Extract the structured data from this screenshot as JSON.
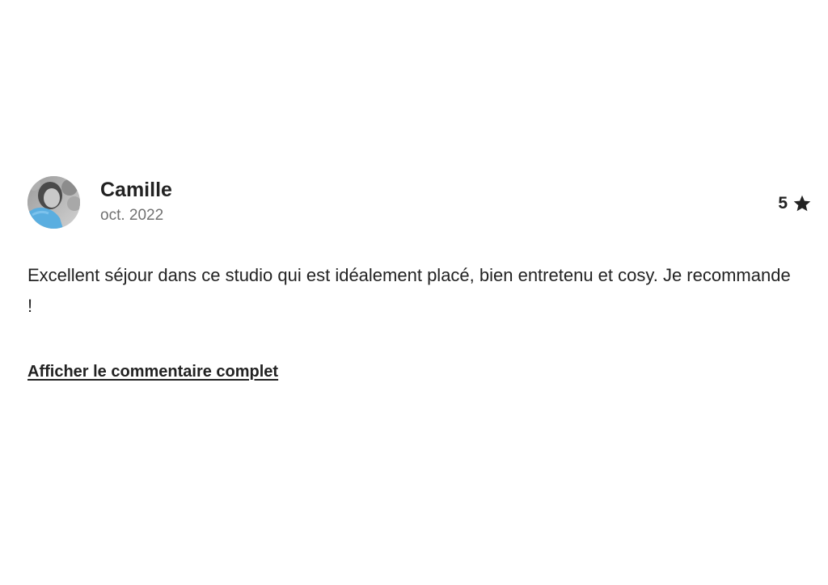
{
  "review": {
    "reviewer_name": "Camille",
    "date": "oct. 2022",
    "rating": "5",
    "rating_icon": "star-icon",
    "text": "Excellent séjour dans ce studio qui est idéalement placé, bien entretenu et cosy. Je recommande !",
    "show_full_link": "Afficher le commentaire complet"
  },
  "colors": {
    "text_primary": "#222222",
    "text_secondary": "#717171",
    "background": "#ffffff",
    "avatar_jacket": "#5aaee0"
  }
}
